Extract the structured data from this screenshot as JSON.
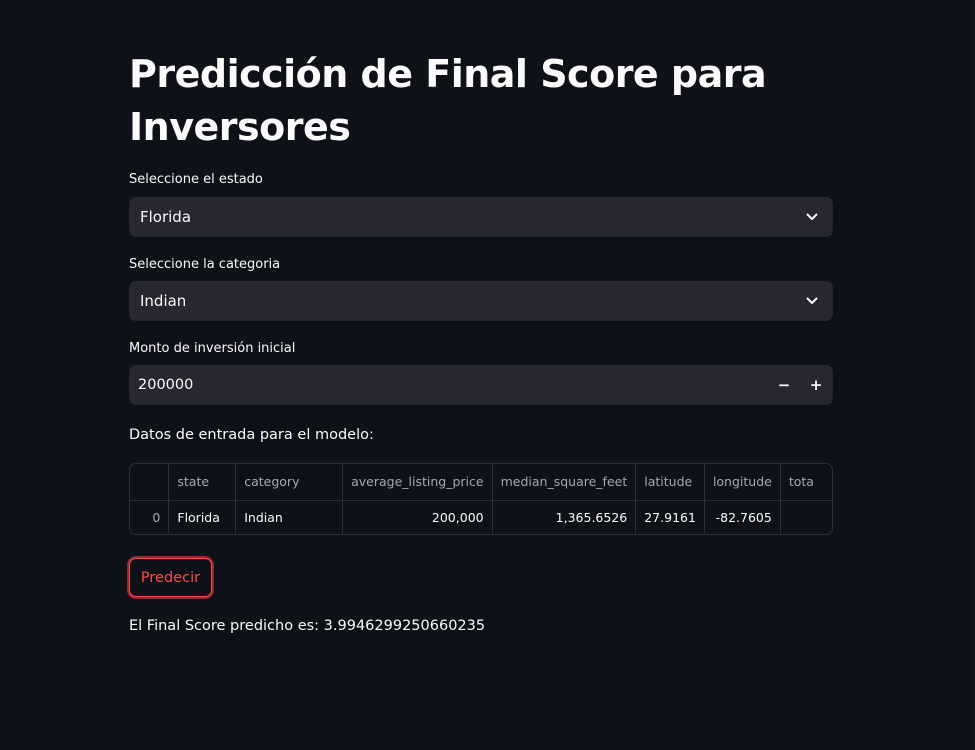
{
  "page": {
    "title": "Predicción de Final Score para Inversores"
  },
  "state_select": {
    "label": "Seleccione el estado",
    "value": "Florida",
    "icon": "chevron-down-icon"
  },
  "category_select": {
    "label": "Seleccione la categoria",
    "value": "Indian",
    "icon": "chevron-down-icon"
  },
  "investment_input": {
    "label": "Monto de inversión inicial",
    "value": "200000",
    "decrement_label": "−",
    "increment_label": "+"
  },
  "model_input": {
    "heading": "Datos de entrada para el modelo:",
    "columns": [
      "",
      "state",
      "category",
      "average_listing_price",
      "median_square_feet",
      "latitude",
      "longitude",
      "tota"
    ],
    "rows": [
      {
        "index": "0",
        "state": "Florida",
        "category": "Indian",
        "average_listing_price": "200,000",
        "median_square_feet": "1,365.6526",
        "latitude": "27.9161",
        "longitude": "-82.7605",
        "tota": ""
      }
    ]
  },
  "predict_button": {
    "label": "Predecir"
  },
  "result": {
    "text": "El Final Score predicho es: 3.9946299250660235"
  },
  "colors": {
    "background": "#0e1117",
    "widget": "#262730",
    "accent": "#ff4b4b",
    "text": "#fafafa"
  }
}
